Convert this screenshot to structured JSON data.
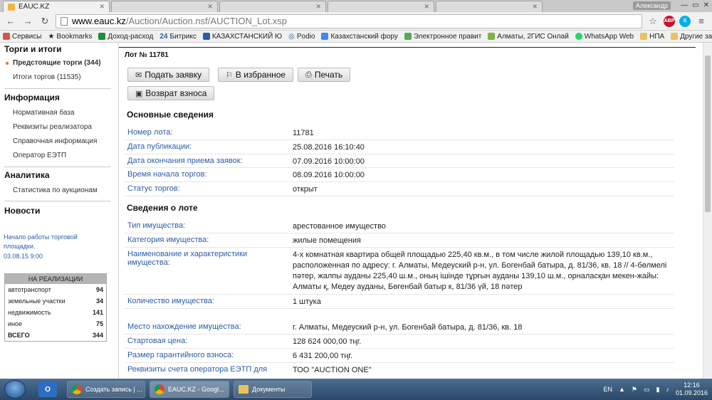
{
  "browser": {
    "tabs": [
      {
        "title": "EAUC.KZ",
        "active": true
      },
      {
        "title": "",
        "active": false
      },
      {
        "title": "",
        "active": false
      },
      {
        "title": "",
        "active": false
      },
      {
        "title": "",
        "active": false
      }
    ],
    "user_name": "Александр",
    "url_domain": "www.eauc.kz",
    "url_path": "/Auction/Auction.nsf/AUCTION_Lot.xsp",
    "extensions": [
      {
        "label": "ABP",
        "color": "#c8102e"
      },
      {
        "label": "S",
        "color": "#00aff0"
      }
    ],
    "bookmarks": [
      "Сервисы",
      "Bookmarks",
      "Доход-расход",
      "Битрикс",
      "КАЗАХСТАНСКИЙ Ю",
      "Podio",
      "Казахстанский фору",
      "Электронное правит",
      "Алматы, 2ГИС Онлай",
      "WhatsApp Web",
      "НПА"
    ],
    "bookmark_bitrix_prefix": "24",
    "other_bookmarks": "Другие закладки"
  },
  "sidebar": {
    "trading_heading": "Торги и итоги",
    "upcoming": "Предстоящие торги (344)",
    "results": "Итоги торгов (11535)",
    "info_heading": "Информация",
    "info_items": [
      "Нормативная база",
      "Реквизиты реализатора",
      "Справочная информация",
      "Оператор ЕЭТП"
    ],
    "analytics_heading": "Аналитика",
    "analytics_items": [
      "Статистика по аукционам"
    ],
    "news_heading": "Новости",
    "news_text": "Начало работы торговой площадки.",
    "news_date": "03.08.15 9:00",
    "sale": {
      "heading": "НА РЕАЛИЗАЦИИ",
      "rows": [
        {
          "label": "автотранспорт",
          "count": "94"
        },
        {
          "label": "земельные участки",
          "count": "34"
        },
        {
          "label": "недвижимость",
          "count": "141"
        },
        {
          "label": "иное",
          "count": "75"
        },
        {
          "label": "ВСЕГО",
          "count": "344"
        }
      ]
    }
  },
  "lot": {
    "title": "Лот № 11781",
    "buttons": {
      "apply": "Подать заявку",
      "favorite": "В избранное",
      "print": "Печать",
      "refund": "Возврат взноса"
    },
    "basic_heading": "Основные сведения",
    "basic": [
      {
        "label": "Номер лота:",
        "value": "11781"
      },
      {
        "label": "Дата публикации:",
        "value": "25.08.2016 16:10:40"
      },
      {
        "label": "Дата окончания приема заявок:",
        "value": "07.09.2016 10:00:00"
      },
      {
        "label": "Время начала торгов:",
        "value": "08.09.2016 10:00:00"
      },
      {
        "label": "Статус торгов:",
        "value": "открыт"
      }
    ],
    "details_heading": "Сведения о лоте",
    "details": [
      {
        "label": "Тип имущества:",
        "value": "арестованное имущество"
      },
      {
        "label": "Категория имущества:",
        "value": "жилые помещения"
      },
      {
        "label": "Наименование и характеристики имущества:",
        "value": "4-х комнатная квартира общей площадью 225,40 кв.м., в том числе жилой площадью 139,10 кв.м., расположенная по адресу: г. Алматы, Медеуский р-н, ул. Богенбай батыра, д. 81/36, кв. 18 // 4-бөлмелі пәтер, жалпы ауданы 225,40 ш.м., оның ішінде тұрғын ауданы 139,10 ш.м., орналасқан мекен-жайы: Алматы қ, Медеу ауданы, Бөгенбай батыр к, 81/36 үй, 18 пәтер"
      },
      {
        "label": "Количество имущества:",
        "value": "1 штука"
      },
      {
        "label": "Место нахождение имущества:",
        "value": "г. Алматы, Медеуский р-н, ул. Богенбай батыра, д. 81/36, кв. 18"
      },
      {
        "label": "Стартовая цена:",
        "value": "128 624 000,00 тңг."
      },
      {
        "label": "Размер гарантийного взноса:",
        "value": "6 431 200,00 тңг."
      },
      {
        "label": "Реквизиты счета оператора ЕЭТП для",
        "value": "ТОО \"AUCTION ONE\""
      }
    ]
  },
  "taskbar": {
    "outlook_label": "O",
    "tasks": [
      "Создать запись | ...",
      "EAUC.KZ - Googl...",
      "Документы"
    ],
    "lang": "EN",
    "time": "12:16",
    "date": "01.09.2016"
  }
}
